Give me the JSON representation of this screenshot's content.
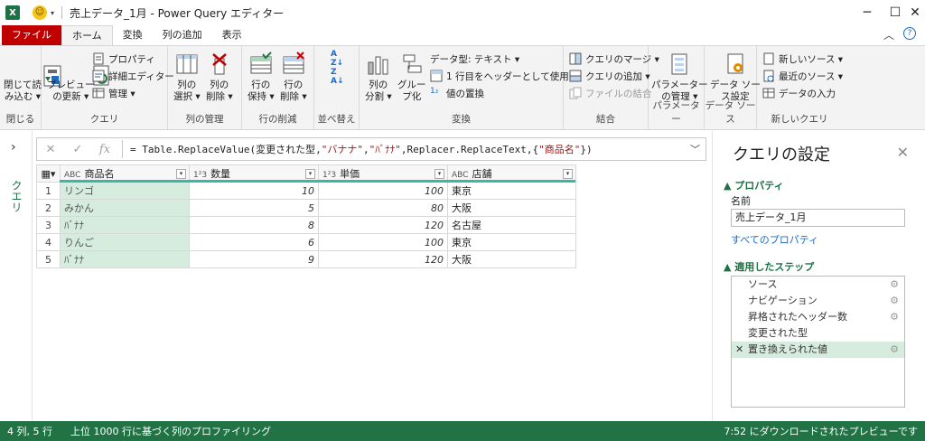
{
  "titlebar": {
    "app_letter": "X",
    "title": "売上データ_1月 - Power Query エディター",
    "minimize": "─",
    "maximize": "☐",
    "close": "✕"
  },
  "tabs": {
    "file": "ファイル",
    "home": "ホーム",
    "transform": "変換",
    "add_column": "列の追加",
    "view": "表示"
  },
  "ribbon": {
    "close_group": {
      "btn": "閉じて読\nみ込む ▾",
      "label": "閉じる"
    },
    "query_group": {
      "refresh": "プレビュー\nの更新 ▾",
      "properties": "プロパティ",
      "advanced_editor": "詳細エディター",
      "manage": "管理 ▾",
      "label": "クエリ"
    },
    "columns_group": {
      "choose": "列の\n選択 ▾",
      "remove": "列の\n削除 ▾",
      "label": "列の管理"
    },
    "rows_group": {
      "keep": "行の\n保持 ▾",
      "remove": "行の\n削除 ▾",
      "label": "行の削減"
    },
    "sort_group": {
      "label": "並べ替え"
    },
    "transform_group": {
      "split": "列の\n分割 ▾",
      "group_by": "グルー\nプ化",
      "data_type": "データ型: テキスト ▾",
      "first_row": "1 行目をヘッダーとして使用 ▾",
      "replace": "値の置換",
      "label": "変換"
    },
    "combine_group": {
      "merge": "クエリのマージ ▾",
      "append": "クエリの追加 ▾",
      "combine_files": "ファイルの結合",
      "label": "結合"
    },
    "params_group": {
      "manage": "パラメーター\nの管理 ▾",
      "label": "パラメーター"
    },
    "datasource_group": {
      "settings": "データ ソー\nス設定",
      "label": "データ ソース"
    },
    "newquery_group": {
      "new_source": "新しいソース ▾",
      "recent": "最近のソース ▾",
      "enter_data": "データの入力",
      "label": "新しいクエリ"
    }
  },
  "nav": {
    "label": "クエリ"
  },
  "formula": {
    "prefix": "= Table.ReplaceValue(変更された型,",
    "s1": "\"バナナ\"",
    "comma1": ",",
    "s2": "\"ﾊﾞﾅﾅ\"",
    "mid": ",Replacer.ReplaceText,{",
    "s3": "\"商品名\"",
    "suffix": "})"
  },
  "table": {
    "columns": [
      {
        "type": "ABC",
        "name": "商品名"
      },
      {
        "type": "1²3",
        "name": "数量"
      },
      {
        "type": "1²3",
        "name": "単価"
      },
      {
        "type": "ABC",
        "name": "店舗"
      }
    ],
    "rows": [
      [
        "1",
        "リンゴ",
        "10",
        "100",
        "東京"
      ],
      [
        "2",
        "みかん",
        "5",
        "80",
        "大阪"
      ],
      [
        "3",
        "ﾊﾞﾅﾅ",
        "8",
        "120",
        "名古屋"
      ],
      [
        "4",
        "りんご",
        "6",
        "100",
        "東京"
      ],
      [
        "5",
        "ﾊﾞﾅﾅ",
        "9",
        "120",
        "大阪"
      ]
    ]
  },
  "pane": {
    "title": "クエリの設定",
    "properties_header": "▲ プロパティ",
    "name_label": "名前",
    "name_value": "売上データ_1月",
    "all_props": "すべてのプロパティ",
    "steps_header": "▲ 適用したステップ",
    "steps": [
      "ソース",
      "ナビゲーション",
      "昇格されたヘッダー数",
      "変更された型",
      "置き換えられた値"
    ]
  },
  "status": {
    "left1": "4 列, 5 行",
    "left2": "上位 1000 行に基づく列のプロファイリング",
    "right": "7:52 にダウンロードされたプレビューです"
  },
  "colors": {
    "accent": "#217346",
    "file_tab": "#c00000",
    "selection": "#d5ecdf",
    "teal": "#3cb6a6"
  }
}
